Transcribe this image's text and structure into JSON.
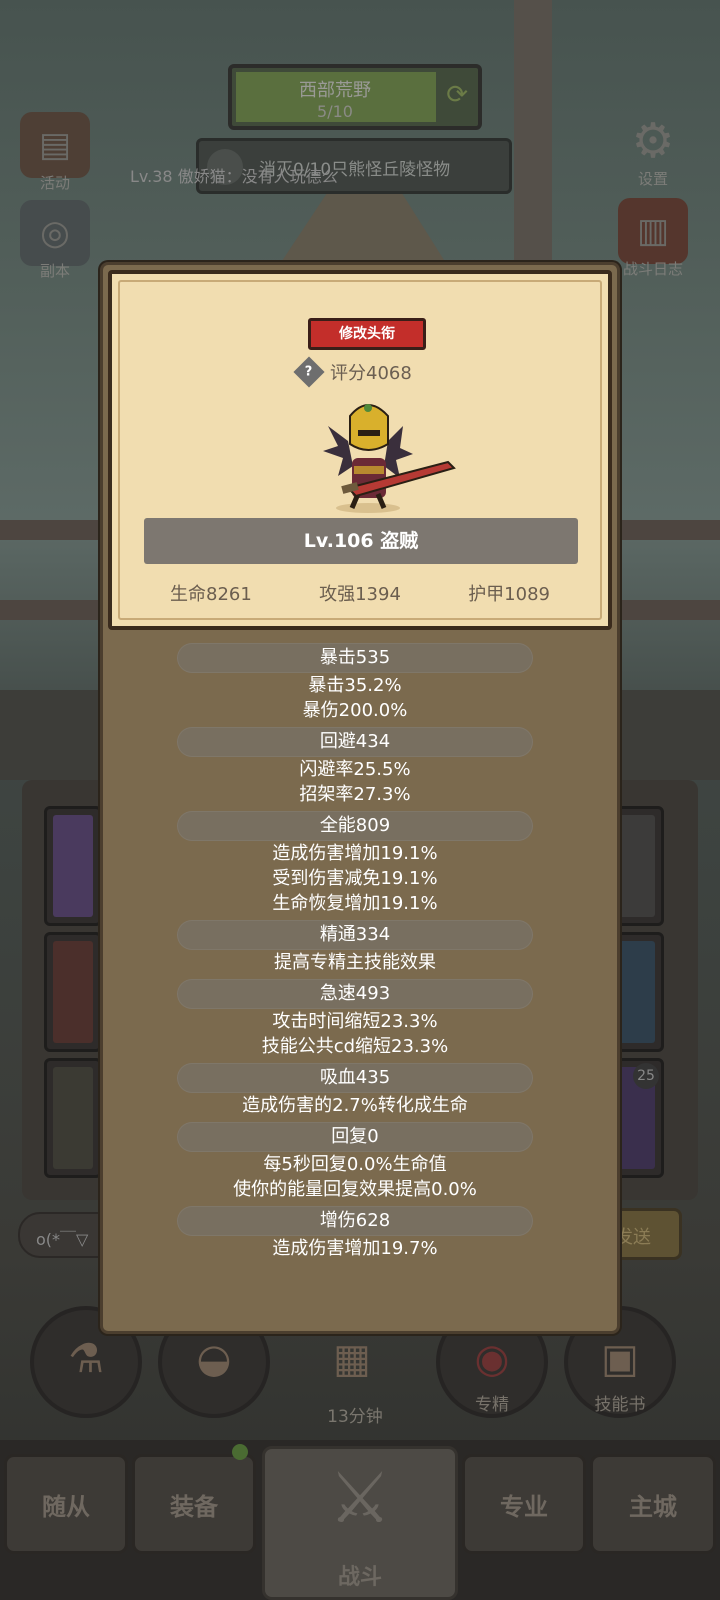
{
  "background": {
    "stage": {
      "name": "西部荒野",
      "progress": "5/10"
    },
    "quest": "消灭0/10只熊怪丘陵怪物",
    "ticker": "Lv.38 傲娇猫：没有人玩德么",
    "left_buttons": [
      {
        "label": "活动",
        "icon": "activity-board-icon"
      },
      {
        "label": "副本",
        "icon": "dungeon-portal-icon"
      }
    ],
    "right_buttons": [
      {
        "label": "设置",
        "icon": "gear-icon"
      },
      {
        "label": "战斗日志",
        "icon": "battle-log-book-icon"
      }
    ],
    "chat_placeholder": "o(*￣▽",
    "send_label": "发送",
    "skill_row": [
      {
        "label": "",
        "icon": "potion-icon"
      },
      {
        "label": "",
        "icon": "bread-icon"
      },
      {
        "label": "13分钟",
        "icon": "treasure-chest-icon"
      },
      {
        "label": "专精",
        "icon": "specialization-icon"
      },
      {
        "label": "技能书",
        "icon": "skill-book-icon"
      }
    ],
    "tile_badge": "25",
    "bottom_nav": [
      "随从",
      "装备",
      "战斗",
      "专业",
      "主城"
    ]
  },
  "modal": {
    "edit_title_button": "修改头衔",
    "help_mark": "?",
    "score": "评分4068",
    "level_class": "Lv.106 盗贼",
    "base_stats": [
      "生命8261",
      "攻强1394",
      "护甲1089"
    ],
    "attributes": [
      {
        "title": "暴击535",
        "lines": [
          "暴击35.2%",
          "暴伤200.0%"
        ]
      },
      {
        "title": "回避434",
        "lines": [
          "闪避率25.5%",
          "招架率27.3%"
        ]
      },
      {
        "title": "全能809",
        "lines": [
          "造成伤害增加19.1%",
          "受到伤害减免19.1%",
          "生命恢复增加19.1%"
        ]
      },
      {
        "title": "精通334",
        "lines": [
          "提高专精主技能效果"
        ]
      },
      {
        "title": "急速493",
        "lines": [
          "攻击时间缩短23.3%",
          "技能公共cd缩短23.3%"
        ]
      },
      {
        "title": "吸血435",
        "lines": [
          "造成伤害的2.7%转化成生命"
        ]
      },
      {
        "title": "回复0",
        "lines": [
          "每5秒回复0.0%生命值",
          "使你的能量回复效果提高0.0%"
        ]
      },
      {
        "title": "增伤628",
        "lines": [
          "造成伤害增加19.7%"
        ]
      }
    ]
  },
  "colors": {
    "edit_button_bg": "#c32e2a",
    "card_bg": "#f1ddb0",
    "modal_bg": "#7b6a4e",
    "attr_header_bg": "#78706e"
  }
}
